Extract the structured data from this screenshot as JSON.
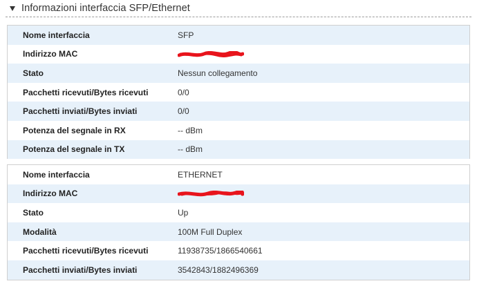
{
  "section": {
    "title": "Informazioni interfaccia SFP/Ethernet"
  },
  "colors": {
    "row_alt": "#e7f1fa",
    "redaction": "#e8141c"
  },
  "sfp": {
    "rows": [
      {
        "label": "Nome interfaccia",
        "value": "SFP"
      },
      {
        "label": "Indirizzo MAC",
        "value": ""
      },
      {
        "label": "Stato",
        "value": "Nessun collegamento"
      },
      {
        "label": "Pacchetti ricevuti/Bytes ricevuti",
        "value": "0/0"
      },
      {
        "label": "Pacchetti inviati/Bytes inviati",
        "value": "0/0"
      },
      {
        "label": "Potenza del segnale in RX",
        "value": "-- dBm"
      },
      {
        "label": "Potenza del segnale in TX",
        "value": "-- dBm"
      }
    ]
  },
  "ethernet": {
    "rows": [
      {
        "label": "Nome interfaccia",
        "value": "ETHERNET"
      },
      {
        "label": "Indirizzo MAC",
        "value": ""
      },
      {
        "label": "Stato",
        "value": "Up"
      },
      {
        "label": "Modalità",
        "value": "100M Full Duplex"
      },
      {
        "label": "Pacchetti ricevuti/Bytes ricevuti",
        "value": "11938735/1866540661"
      },
      {
        "label": "Pacchetti inviati/Bytes inviati",
        "value": "3542843/1882496369"
      }
    ]
  }
}
